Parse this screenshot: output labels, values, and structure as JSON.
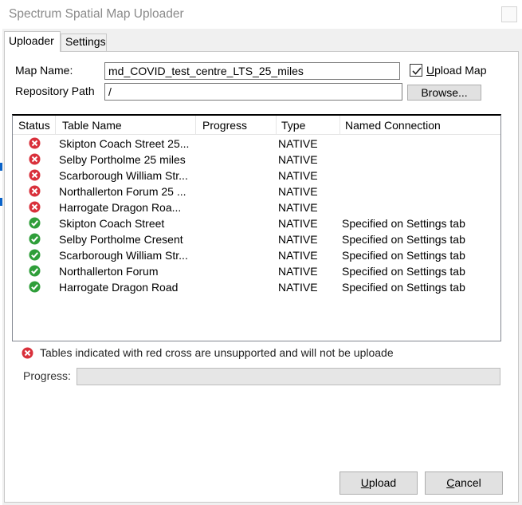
{
  "window": {
    "title": "Spectrum Spatial Map Uploader"
  },
  "tabs": [
    {
      "label": "Uploader",
      "active": true
    },
    {
      "label": "Settings",
      "active": false
    }
  ],
  "form": {
    "map_name_label": "Map Name:",
    "map_name_value": "md_COVID_test_centre_LTS_25_miles",
    "upload_map_label_underlined": "U",
    "upload_map_label_rest": "pload Map",
    "upload_map_checked": true,
    "repository_path_label": "Repository Path",
    "repository_path_value": "/",
    "browse_label": "Browse..."
  },
  "table": {
    "columns": [
      "Status",
      "Table Name",
      "Progress",
      "Type",
      "Named Connection"
    ],
    "rows": [
      {
        "status": "unsupported",
        "name": "Skipton Coach Street 25...",
        "progress": "",
        "type": "NATIVE",
        "connection": ""
      },
      {
        "status": "unsupported",
        "name": "Selby Portholme 25 miles",
        "progress": "",
        "type": "NATIVE",
        "connection": ""
      },
      {
        "status": "unsupported",
        "name": "Scarborough William Str...",
        "progress": "",
        "type": "NATIVE",
        "connection": ""
      },
      {
        "status": "unsupported",
        "name": "Northallerton Forum 25 ...",
        "progress": "",
        "type": "NATIVE",
        "connection": ""
      },
      {
        "status": "unsupported",
        "name": "Harrogate Dragon  Roa...",
        "progress": "",
        "type": "NATIVE",
        "connection": ""
      },
      {
        "status": "supported",
        "name": "Skipton Coach Street",
        "progress": "",
        "type": "NATIVE",
        "connection": "Specified on Settings tab"
      },
      {
        "status": "supported",
        "name": "Selby Portholme Cresent",
        "progress": "",
        "type": "NATIVE",
        "connection": "Specified on Settings tab"
      },
      {
        "status": "supported",
        "name": "Scarborough William Str...",
        "progress": "",
        "type": "NATIVE",
        "connection": "Specified on Settings tab"
      },
      {
        "status": "supported",
        "name": "Northallerton Forum",
        "progress": "",
        "type": "NATIVE",
        "connection": "Specified on Settings tab"
      },
      {
        "status": "supported",
        "name": "Harrogate Dragon Road",
        "progress": "",
        "type": "NATIVE",
        "connection": "Specified on Settings tab"
      }
    ]
  },
  "warning_text": "Tables indicated with red cross are unsupported and will not be uploade",
  "progress": {
    "label": "Progress:",
    "value": 0
  },
  "buttons": {
    "upload_underlined": "U",
    "upload_rest": "pload",
    "cancel_underlined": "C",
    "cancel_rest": "ancel"
  },
  "colors": {
    "error_red": "#d9303b",
    "success_green": "#2f9e3a",
    "accent_blue": "#0a63c9"
  },
  "icons": {
    "unsupported": "red-cross-icon",
    "supported": "green-check-icon"
  }
}
